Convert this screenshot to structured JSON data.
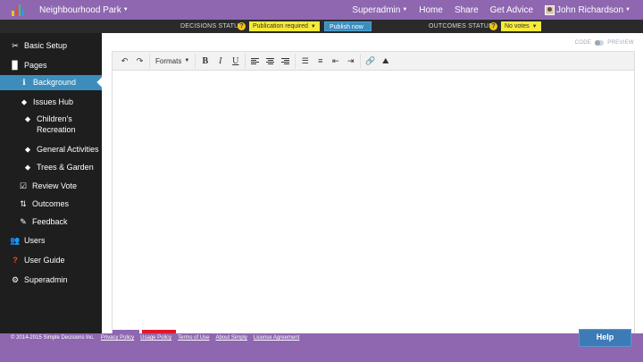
{
  "topbar": {
    "app_title": "Neighbourhood Park",
    "superadmin": "Superadmin",
    "home": "Home",
    "share": "Share",
    "get_advice": "Get Advice",
    "user_name": "John Richardson",
    "logo_colors": [
      "#f0c419",
      "#e74c3c",
      "#2ecc71",
      "#3498db"
    ]
  },
  "status": {
    "decisions_label": "DECISIONS STATUS",
    "decisions_value": "Publication required",
    "publish_button": "Publish now",
    "outcomes_label": "OUTCOMES STATUS",
    "outcomes_value": "No votes"
  },
  "sidebar": {
    "items": [
      {
        "icon": "✂",
        "label": "Basic Setup"
      },
      {
        "icon": "▉",
        "label": "Pages"
      },
      {
        "icon": "ℹ",
        "label": "Background"
      },
      {
        "icon": "⬥",
        "label": "Issues Hub"
      },
      {
        "icon": "⬥",
        "label": "Children's Recreation"
      },
      {
        "icon": "⬥",
        "label": "General Activities"
      },
      {
        "icon": "⬥",
        "label": "Trees & Garden"
      },
      {
        "icon": "☑",
        "label": "Review Vote"
      },
      {
        "icon": "⇅",
        "label": "Outcomes"
      },
      {
        "icon": "✎",
        "label": "Feedback"
      },
      {
        "icon": "👥",
        "label": "Users"
      },
      {
        "icon": "?",
        "label": "User Guide"
      },
      {
        "icon": "⚙",
        "label": "Superadmin"
      }
    ]
  },
  "editor": {
    "code_label": "CODE",
    "preview_label": "PREVIEW",
    "formats_label": "Formats"
  },
  "footer": {
    "copyright": "© 2014-2015 Simple Decisions Inc.",
    "links": [
      "Privacy Policy",
      "Usage Policy",
      "Terms of Use",
      "About Simply",
      "License Agreement"
    ],
    "help": "Help"
  },
  "colors": {
    "purple": "#8e67b0",
    "dark": "#1e1e1e",
    "accent": "#3c8dbc",
    "yellow": "#f6ea3b"
  }
}
